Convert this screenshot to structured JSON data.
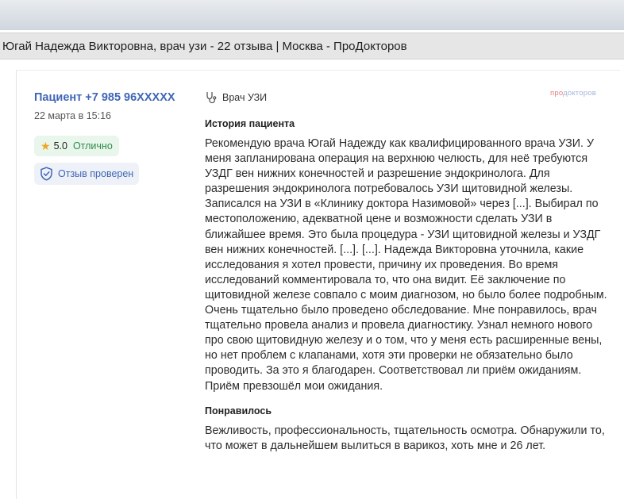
{
  "window": {
    "title": "Югай Надежда Викторовна, врач узи - 22 отзыва | Москва - ПроДокторов"
  },
  "review": {
    "patient": "Пациент +7 985 96XXXXX",
    "date": "22 марта в 15:16",
    "rating_score": "5.0",
    "rating_label": "Отлично",
    "verified_label": "Отзыв проверен",
    "specialty": "Врач УЗИ",
    "brand_prefix": "про",
    "brand_suffix": "докторов",
    "story_title": "История пациента",
    "story_text": "Рекомендую врача Югай Надежду как квалифицированного врача УЗИ. У меня запланирована операция на верхнюю челюсть, для неё требуются УЗДГ вен нижних конечностей и разрешение эндокринолога. Для разрешения эндокринолога потребовалось УЗИ щитовидной железы. Записался на УЗИ в «Клинику доктора Назимовой» через [...]. Выбирал по местоположению, адекватной цене и возможности сделать УЗИ в ближайшее время. Это была процедура - УЗИ щитовидной железы и УЗДГ вен нижних конечностей. [...]. [...]. Надежда Викторовна уточнила, какие исследования я хотел провести, причину их проведения. Во время исследований комментировала то, что она видит. Её заключение по щитовидной железе совпало с моим диагнозом, но было более подробным. Очень тщательно было проведено обследование. Мне понравилось, врач тщательно провела анализ и провела диагностику. Узнал немного нового про свою щитовидную железу и о том, что у меня есть расширенные вены, но нет проблем с клапанами, хотя эти проверки не обязательно было проводить. За это я благодарен. Соответствовал ли приём ожиданиям. Приём превзошёл мои ожидания.",
    "liked_title": "Понравилось",
    "liked_text": "Вежливость, профессиональность, тщательность осмотра. Обнаружили то, что может в дальнейшем вылиться в варикоз, хоть мне и 26 лет."
  },
  "colors": {
    "accent": "#3f66b5",
    "rating_bg": "#e9f6ec",
    "rating_text": "#2f8a4a",
    "star": "#f3a323"
  },
  "icons": [
    "star-icon",
    "shield-check-icon",
    "stethoscope-icon"
  ]
}
